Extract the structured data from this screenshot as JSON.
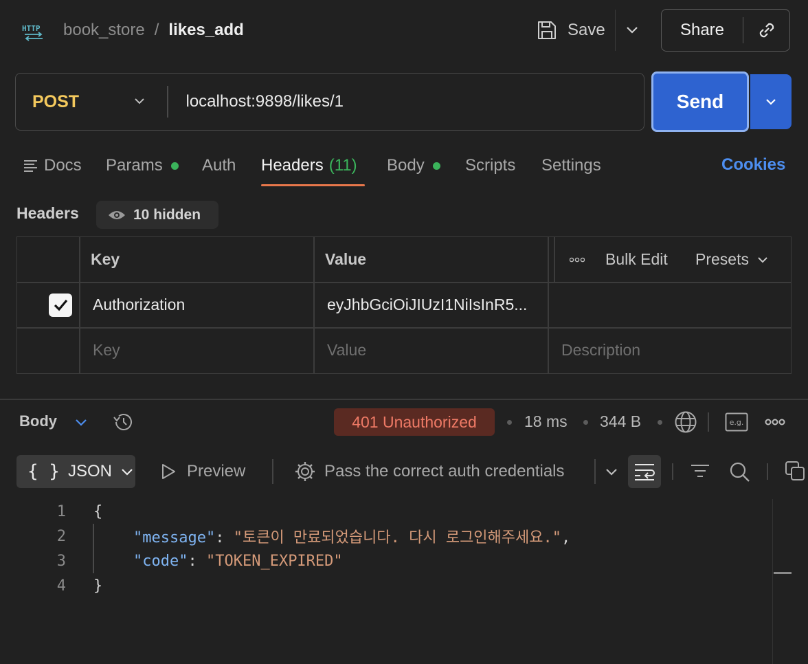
{
  "topbar": {
    "protocol_icon": "http-icon",
    "breadcrumb_parent": "book_store",
    "breadcrumb_sep": "/",
    "breadcrumb_current": "likes_add",
    "save_label": "Save",
    "share_label": "Share"
  },
  "request": {
    "method": "POST",
    "url": "localhost:9898/likes/1",
    "send_label": "Send"
  },
  "tabs": [
    {
      "label": "Docs",
      "icon": "docs-icon"
    },
    {
      "label": "Params",
      "dot": true
    },
    {
      "label": "Auth"
    },
    {
      "label": "Headers",
      "count": "(11)",
      "active": true
    },
    {
      "label": "Body",
      "dot": true
    },
    {
      "label": "Scripts"
    },
    {
      "label": "Settings"
    }
  ],
  "cookies_label": "Cookies",
  "headers_section": {
    "title": "Headers",
    "hidden_label": "10 hidden",
    "columns": {
      "key": "Key",
      "value": "Value"
    },
    "bulk_edit_label": "Bulk Edit",
    "presets_label": "Presets",
    "rows": [
      {
        "checked": true,
        "key": "Authorization",
        "value": "eyJhbGciOiJIUzI1NiIsInR5..."
      }
    ],
    "placeholders": {
      "key": "Key",
      "value": "Value",
      "description": "Description"
    }
  },
  "response": {
    "body_label": "Body",
    "status": "401 Unauthorized",
    "time": "18 ms",
    "size": "344 B",
    "format": "JSON",
    "preview_label": "Preview",
    "visualize_label": "Pass the correct auth credentials",
    "status_color": "#ef7a66",
    "lines": [
      {
        "n": "1"
      },
      {
        "n": "2"
      },
      {
        "n": "3"
      },
      {
        "n": "4"
      }
    ],
    "json": {
      "open": "{",
      "close": "}",
      "key1": "\"message\"",
      "val1": "\"토큰이 만료되었습니다. 다시 로그인해주세요.\"",
      "key2": "\"code\"",
      "val2": "\"TOKEN_EXPIRED\""
    }
  },
  "colors": {
    "accent": "#2e63d0",
    "method": "#f4c95d",
    "active_tab_underline": "#e8774b",
    "dot": "#3bb35b",
    "link": "#4d8ef0"
  }
}
